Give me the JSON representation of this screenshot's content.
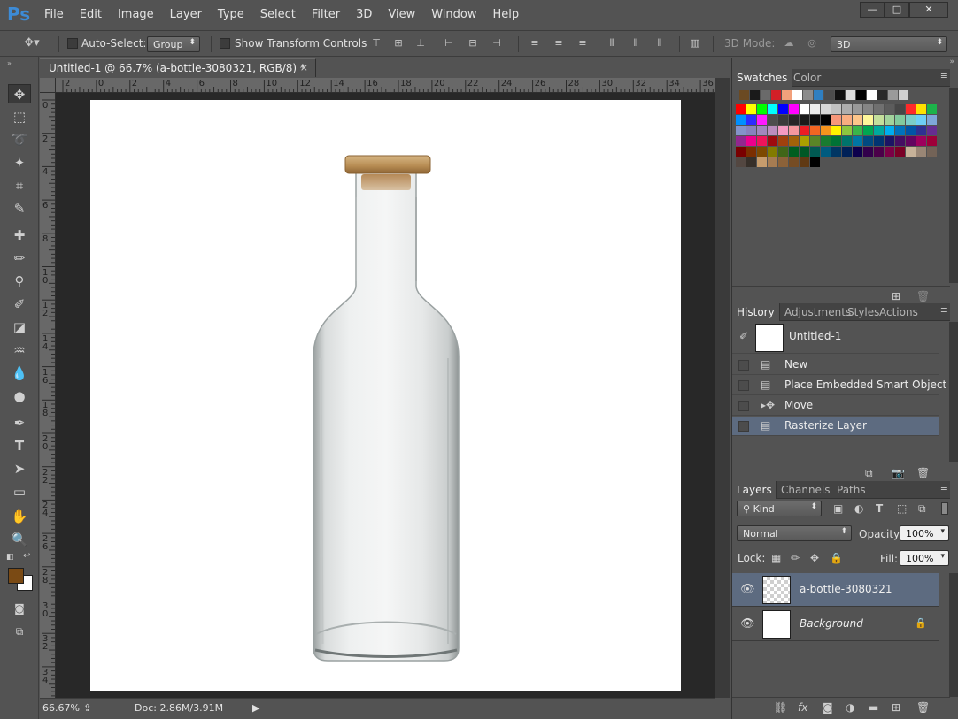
{
  "app": {
    "logo": "Ps"
  },
  "menu": [
    "File",
    "Edit",
    "Image",
    "Layer",
    "Type",
    "Select",
    "Filter",
    "3D",
    "View",
    "Window",
    "Help"
  ],
  "window_controls": {
    "minimize": "—",
    "maximize": "□",
    "close": "✕"
  },
  "options_bar": {
    "auto_select_label": "Auto-Select:",
    "auto_select_value": "Group",
    "show_transform_label": "Show Transform Controls",
    "mode_3d_label": "3D Mode:",
    "mode_3d_value": "3D"
  },
  "document": {
    "tab_title": "Untitled-1 @ 66.7% (a-bottle-3080321, RGB/8) *",
    "close": "×"
  },
  "ruler": {
    "h_ticks": [
      "2",
      "0",
      "2",
      "4",
      "6",
      "8",
      "10",
      "12",
      "14",
      "16",
      "18",
      "20",
      "22",
      "24",
      "26",
      "28",
      "30",
      "32",
      "34",
      "36"
    ],
    "v_ticks": [
      "0",
      "2",
      "4",
      "6",
      "8",
      "10",
      "12",
      "14",
      "16",
      "18",
      "20",
      "22",
      "24",
      "26",
      "28",
      "30",
      "32",
      "34"
    ]
  },
  "status": {
    "zoom": "66.67%",
    "doc_size": "Doc: 2.86M/3.91M"
  },
  "colors": {
    "foreground": "#7a4a14",
    "background": "#ffffff",
    "selection": "#5d6b80"
  },
  "panels": {
    "swatches": {
      "tabs": [
        "Swatches",
        "Color"
      ]
    },
    "history": {
      "tabs": [
        "History",
        "Adjustments",
        "Styles",
        "Actions"
      ],
      "snapshot": "Untitled-1",
      "items": [
        "New",
        "Place Embedded Smart Object",
        "Move",
        "Rasterize Layer"
      ]
    },
    "layers": {
      "tabs": [
        "Layers",
        "Channels",
        "Paths"
      ],
      "filter_kind": "Kind",
      "blend_mode": "Normal",
      "opacity_label": "Opacity:",
      "opacity_value": "100%",
      "lock_label": "Lock:",
      "fill_label": "Fill:",
      "fill_value": "100%",
      "items": [
        "a-bottle-3080321",
        "Background"
      ]
    }
  }
}
